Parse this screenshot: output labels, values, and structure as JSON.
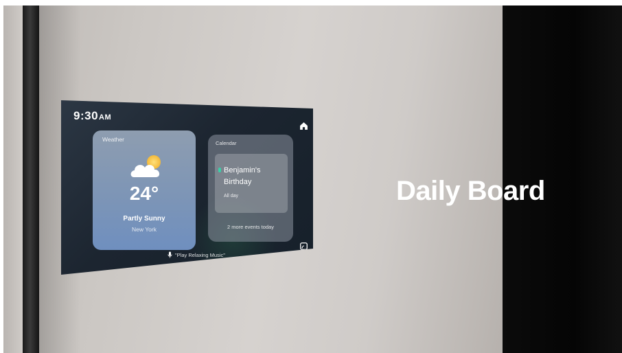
{
  "tagline": "Daily Board",
  "device": {
    "clock": {
      "time": "9:30",
      "ampm": "AM"
    },
    "weather": {
      "title": "Weather",
      "icon": "partly-sunny-icon",
      "temperature": "24°",
      "condition": "Partly Sunny",
      "city": "New York"
    },
    "calendar": {
      "title": "Calendar",
      "event_title": "Benjamin's Birthday",
      "event_time": "All day",
      "more_events": "2 more events today",
      "accent_color": "#3ad0a8"
    },
    "voice_hint": "\"Play Relaxing Music\"",
    "icons": [
      "home-icon",
      "cast-icon",
      "mic-icon"
    ]
  }
}
